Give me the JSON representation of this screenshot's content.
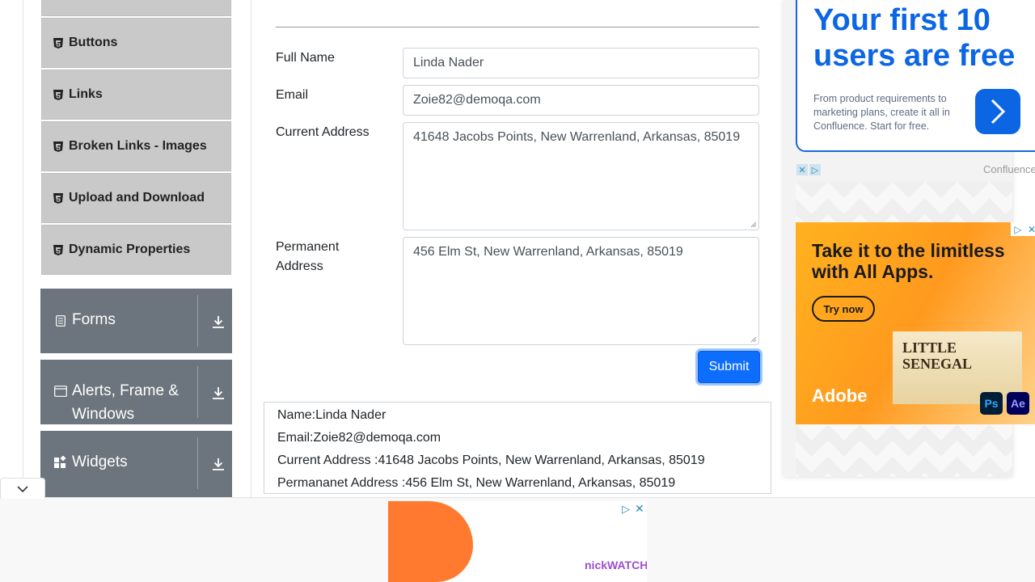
{
  "sidebar": {
    "elements_items": [
      {
        "label": "Buttons"
      },
      {
        "label": "Links"
      },
      {
        "label": "Broken Links - Images"
      },
      {
        "label": "Upload and Download"
      },
      {
        "label": "Dynamic Properties"
      }
    ],
    "groups": [
      {
        "label": "Forms"
      },
      {
        "label": "Alerts, Frame & Windows"
      },
      {
        "label": "Widgets"
      }
    ]
  },
  "form": {
    "full_name_label": "Full Name",
    "full_name_value": "Linda Nader",
    "email_label": "Email",
    "email_value": "Zoie82@demoqa.com",
    "current_address_label": "Current Address",
    "current_address_value": "41648 Jacobs Points, New Warrenland, Arkansas, 85019",
    "permanent_address_label": "Permanent Address",
    "permanent_address_value": "456 Elm St, New Warrenland, Arkansas, 85019",
    "submit_label": "Submit"
  },
  "output": {
    "name": "Name:Linda Nader",
    "email": "Email:Zoie82@demoqa.com",
    "current_address": "Current Address :41648 Jacobs Points, New Warrenland, Arkansas, 85019",
    "permanent_address": "Permananet Address :456 Elm St, New Warrenland, Arkansas, 85019"
  },
  "ads": {
    "confluence_title": "Your first 10 users are free",
    "confluence_text": "From product requirements to marketing plans, create it all in Confluence. Start for free.",
    "confluence_brand": "Confluence",
    "adobe_title": "Take it to the limitless with All Apps.",
    "adobe_cta": "Try now",
    "adobe_image_text": "LITTLE SENEGAL",
    "adobe_logo": "Adobe",
    "app_ps": "Ps",
    "app_ae": "Ae",
    "bottom_brand": "nickWATCH"
  },
  "colors": {
    "primary": "#0d6efd",
    "sidebar_group": "#6c757d",
    "sidebar_item": "#c9c9c9",
    "confluence_blue": "#0c66e4"
  }
}
